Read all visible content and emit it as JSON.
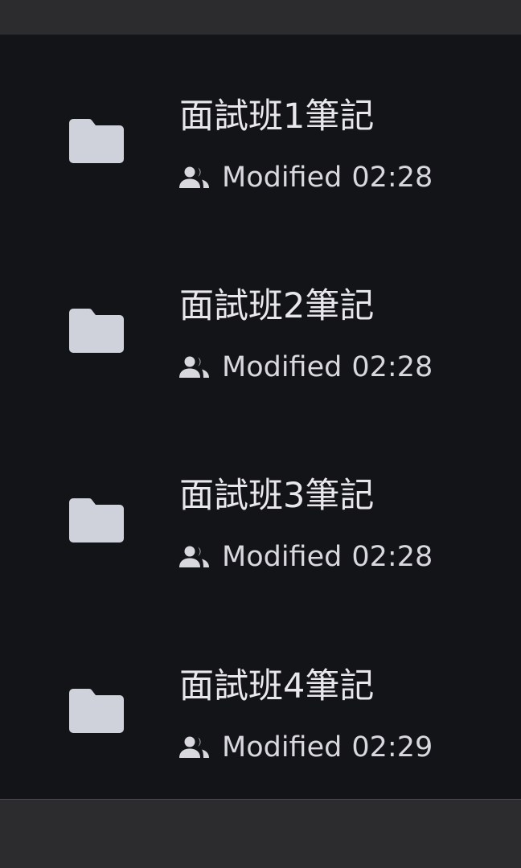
{
  "colors": {
    "background": "#131418",
    "chrome": "#2c2c2e",
    "folder": "#cfd2da",
    "text_primary": "#e8e8ec",
    "text_secondary": "#d8d8de"
  },
  "files": [
    {
      "name": "面試班1筆記",
      "icon": "folder-icon",
      "shared_icon": "people-icon",
      "modified_label": "Modified",
      "modified_time": "02:28"
    },
    {
      "name": "面試班2筆記",
      "icon": "folder-icon",
      "shared_icon": "people-icon",
      "modified_label": "Modified",
      "modified_time": "02:28"
    },
    {
      "name": "面試班3筆記",
      "icon": "folder-icon",
      "shared_icon": "people-icon",
      "modified_label": "Modified",
      "modified_time": "02:28"
    },
    {
      "name": "面試班4筆記",
      "icon": "folder-icon",
      "shared_icon": "people-icon",
      "modified_label": "Modified",
      "modified_time": "02:29"
    }
  ]
}
